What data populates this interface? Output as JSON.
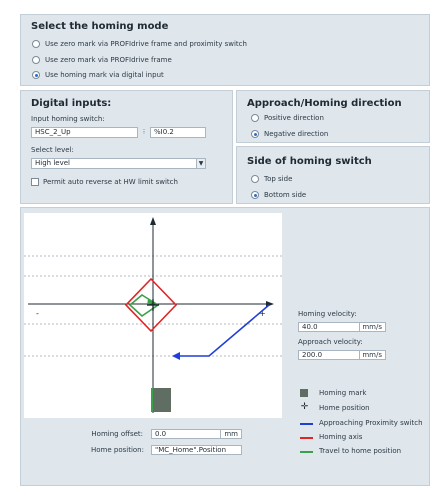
{
  "homing_mode": {
    "title": "Select the homing mode",
    "options": [
      "Use zero mark via PROFIdrive frame and proximity switch",
      "Use zero mark via PROFIdrive frame",
      "Use homing mark via digital input"
    ],
    "selected": 2
  },
  "digital_inputs": {
    "title": "Digital inputs:",
    "input_label": "Input homing switch:",
    "input_value": "HSC_2_Up",
    "address_value": "%I0.2",
    "level_label": "Select level:",
    "level_value": "High level",
    "permit_label": "Permit auto reverse at HW limit switch",
    "permit_checked": false
  },
  "direction": {
    "title": "Approach/Homing direction",
    "options": [
      "Positive direction",
      "Negative direction"
    ],
    "selected": 1
  },
  "side": {
    "title": "Side of homing switch",
    "options": [
      "Top side",
      "Bottom side"
    ],
    "selected": 1
  },
  "velocity": {
    "homing_label": "Homing velocity:",
    "homing_value": "40.0",
    "approach_label": "Approach velocity:",
    "approach_value": "200.0",
    "unit": "mm/s"
  },
  "offset": {
    "offset_label": "Homing offset:",
    "offset_value": "0.0",
    "offset_unit": "mm",
    "position_label": "Home position:",
    "position_value": "\"MC_Home\".Position"
  },
  "legend": [
    {
      "label": "Homing mark",
      "icon": "square",
      "color": "#5f6d63"
    },
    {
      "label": "Home position",
      "icon": "home-position",
      "color": "#1f2a33"
    },
    {
      "label": "Approaching Proximity switch",
      "icon": "line",
      "color": "#1f3fd6"
    },
    {
      "label": "Homing axis",
      "icon": "line",
      "color": "#e02525"
    },
    {
      "label": "Travel to home position",
      "icon": "line",
      "color": "#3aa04a"
    }
  ],
  "diagram": {
    "minus_label": "-",
    "plus_label": "+"
  }
}
